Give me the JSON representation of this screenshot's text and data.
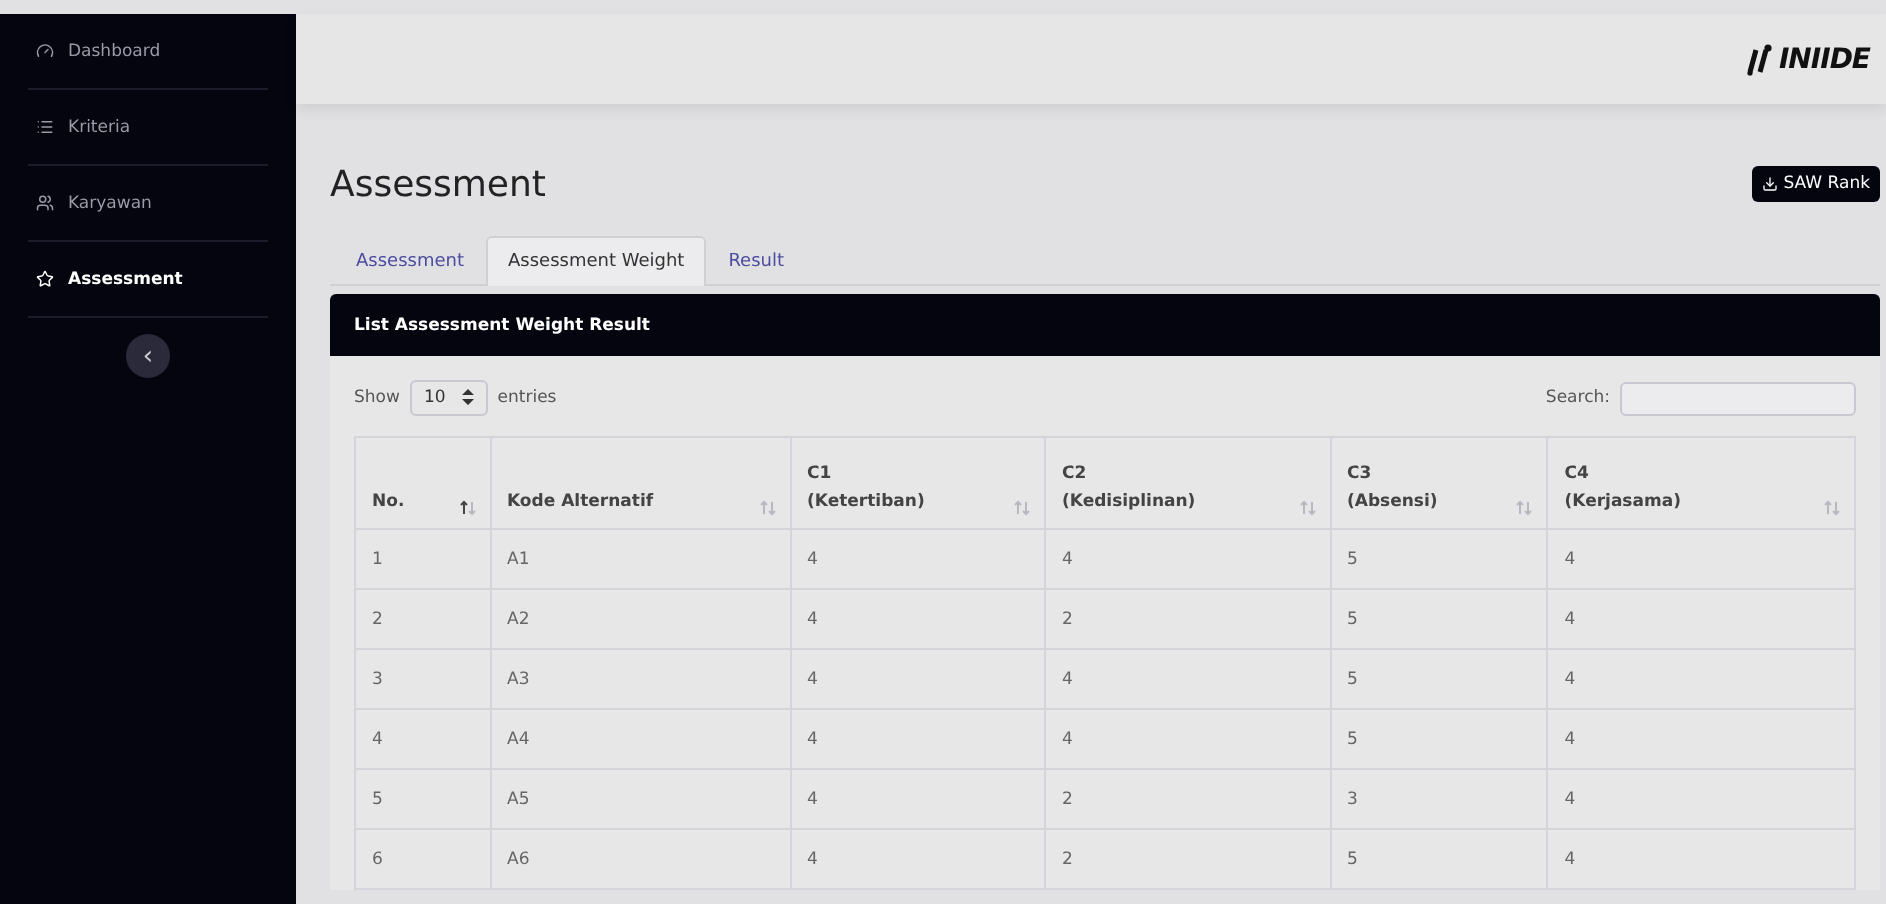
{
  "sidebar": {
    "items": [
      {
        "label": "Dashboard",
        "selected": false
      },
      {
        "label": "Kriteria",
        "selected": false
      },
      {
        "label": "Karyawan",
        "selected": false
      },
      {
        "label": "Assessment",
        "selected": true
      }
    ],
    "collapse_label": "‹"
  },
  "header": {
    "logo": "INIIDE"
  },
  "page": {
    "title": "Assessment",
    "action_button": "SAW Rank"
  },
  "tabs": [
    {
      "label": "Assessment",
      "selected": false
    },
    {
      "label": "Assessment Weight",
      "selected": true
    },
    {
      "label": "Result",
      "selected": false
    }
  ],
  "card": {
    "title": "List Assessment Weight Result",
    "show_label": "Show",
    "entries_value": "10",
    "entries_label": "entries",
    "search_label": "Search:",
    "columns": [
      {
        "code": "No.",
        "sorted": true
      },
      {
        "code": "Kode Alternatif",
        "sorted": false
      },
      {
        "code": "C1",
        "name": "(Ketertiban)",
        "sorted": false
      },
      {
        "code": "C2",
        "name": "(Kedisiplinan)",
        "sorted": false
      },
      {
        "code": "C3",
        "name": "(Absensi)",
        "sorted": false
      },
      {
        "code": "C4",
        "name": "(Kerjasama)",
        "sorted": false
      }
    ],
    "rows": [
      [
        "1",
        "A1",
        "4",
        "4",
        "5",
        "4"
      ],
      [
        "2",
        "A2",
        "4",
        "2",
        "5",
        "4"
      ],
      [
        "3",
        "A3",
        "4",
        "4",
        "5",
        "4"
      ],
      [
        "4",
        "A4",
        "4",
        "4",
        "5",
        "4"
      ],
      [
        "5",
        "A5",
        "4",
        "2",
        "3",
        "4"
      ],
      [
        "6",
        "A6",
        "4",
        "2",
        "5",
        "4"
      ]
    ]
  }
}
